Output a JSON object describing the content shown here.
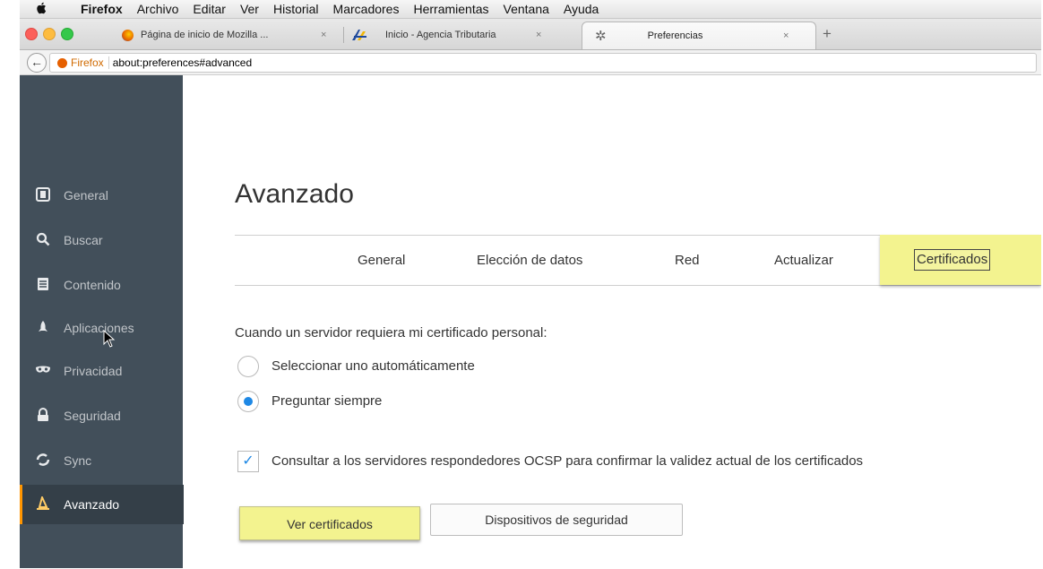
{
  "menubar": {
    "apple_icon": "apple-logo-icon",
    "items": [
      "Firefox",
      "Archivo",
      "Editar",
      "Ver",
      "Historial",
      "Marcadores",
      "Herramientas",
      "Ventana",
      "Ayuda"
    ]
  },
  "tabs": [
    {
      "label": "Página de inicio de Mozilla ...",
      "icon": "firefox-icon",
      "close": "×"
    },
    {
      "label": "Inicio - Agencia Tributaria",
      "icon": "agencia-tributaria-icon",
      "close": "×"
    },
    {
      "label": "Preferencias",
      "icon": "gear-icon",
      "close": "×"
    }
  ],
  "new_tab": "+",
  "navbar": {
    "back": "←",
    "identity": "Firefox",
    "url": "about:preferences#advanced"
  },
  "sidebar": {
    "items": [
      {
        "label": "General",
        "icon": "general-icon"
      },
      {
        "label": "Buscar",
        "icon": "search-icon"
      },
      {
        "label": "Contenido",
        "icon": "document-icon"
      },
      {
        "label": "Aplicaciones",
        "icon": "rocket-icon"
      },
      {
        "label": "Privacidad",
        "icon": "mask-icon"
      },
      {
        "label": "Seguridad",
        "icon": "lock-icon"
      },
      {
        "label": "Sync",
        "icon": "sync-icon"
      },
      {
        "label": "Avanzado",
        "icon": "wizard-hat-icon"
      }
    ],
    "selected": "Avanzado"
  },
  "main": {
    "title": "Avanzado",
    "tabs": [
      "General",
      "Elección de datos",
      "Red",
      "Actualizar",
      "Certificados"
    ],
    "active_tab": "Certificados",
    "cert_label": "Cuando un servidor requiera mi certificado personal:",
    "radios": [
      {
        "label": "Seleccionar uno automáticamente",
        "checked": false
      },
      {
        "label": "Preguntar siempre",
        "checked": true
      }
    ],
    "ocsp": {
      "label": "Consultar a los servidores respondedores OCSP para confirmar la validez actual de los certificados",
      "checked": true
    },
    "buttons": {
      "view_certificates": "Ver certificados",
      "security_devices": "Dispositivos de seguridad"
    }
  },
  "colors": {
    "sidebar_bg": "#424f5a",
    "highlight": "#f3f38f",
    "accent": "#1e88e5",
    "selected_border": "#ff9500"
  }
}
